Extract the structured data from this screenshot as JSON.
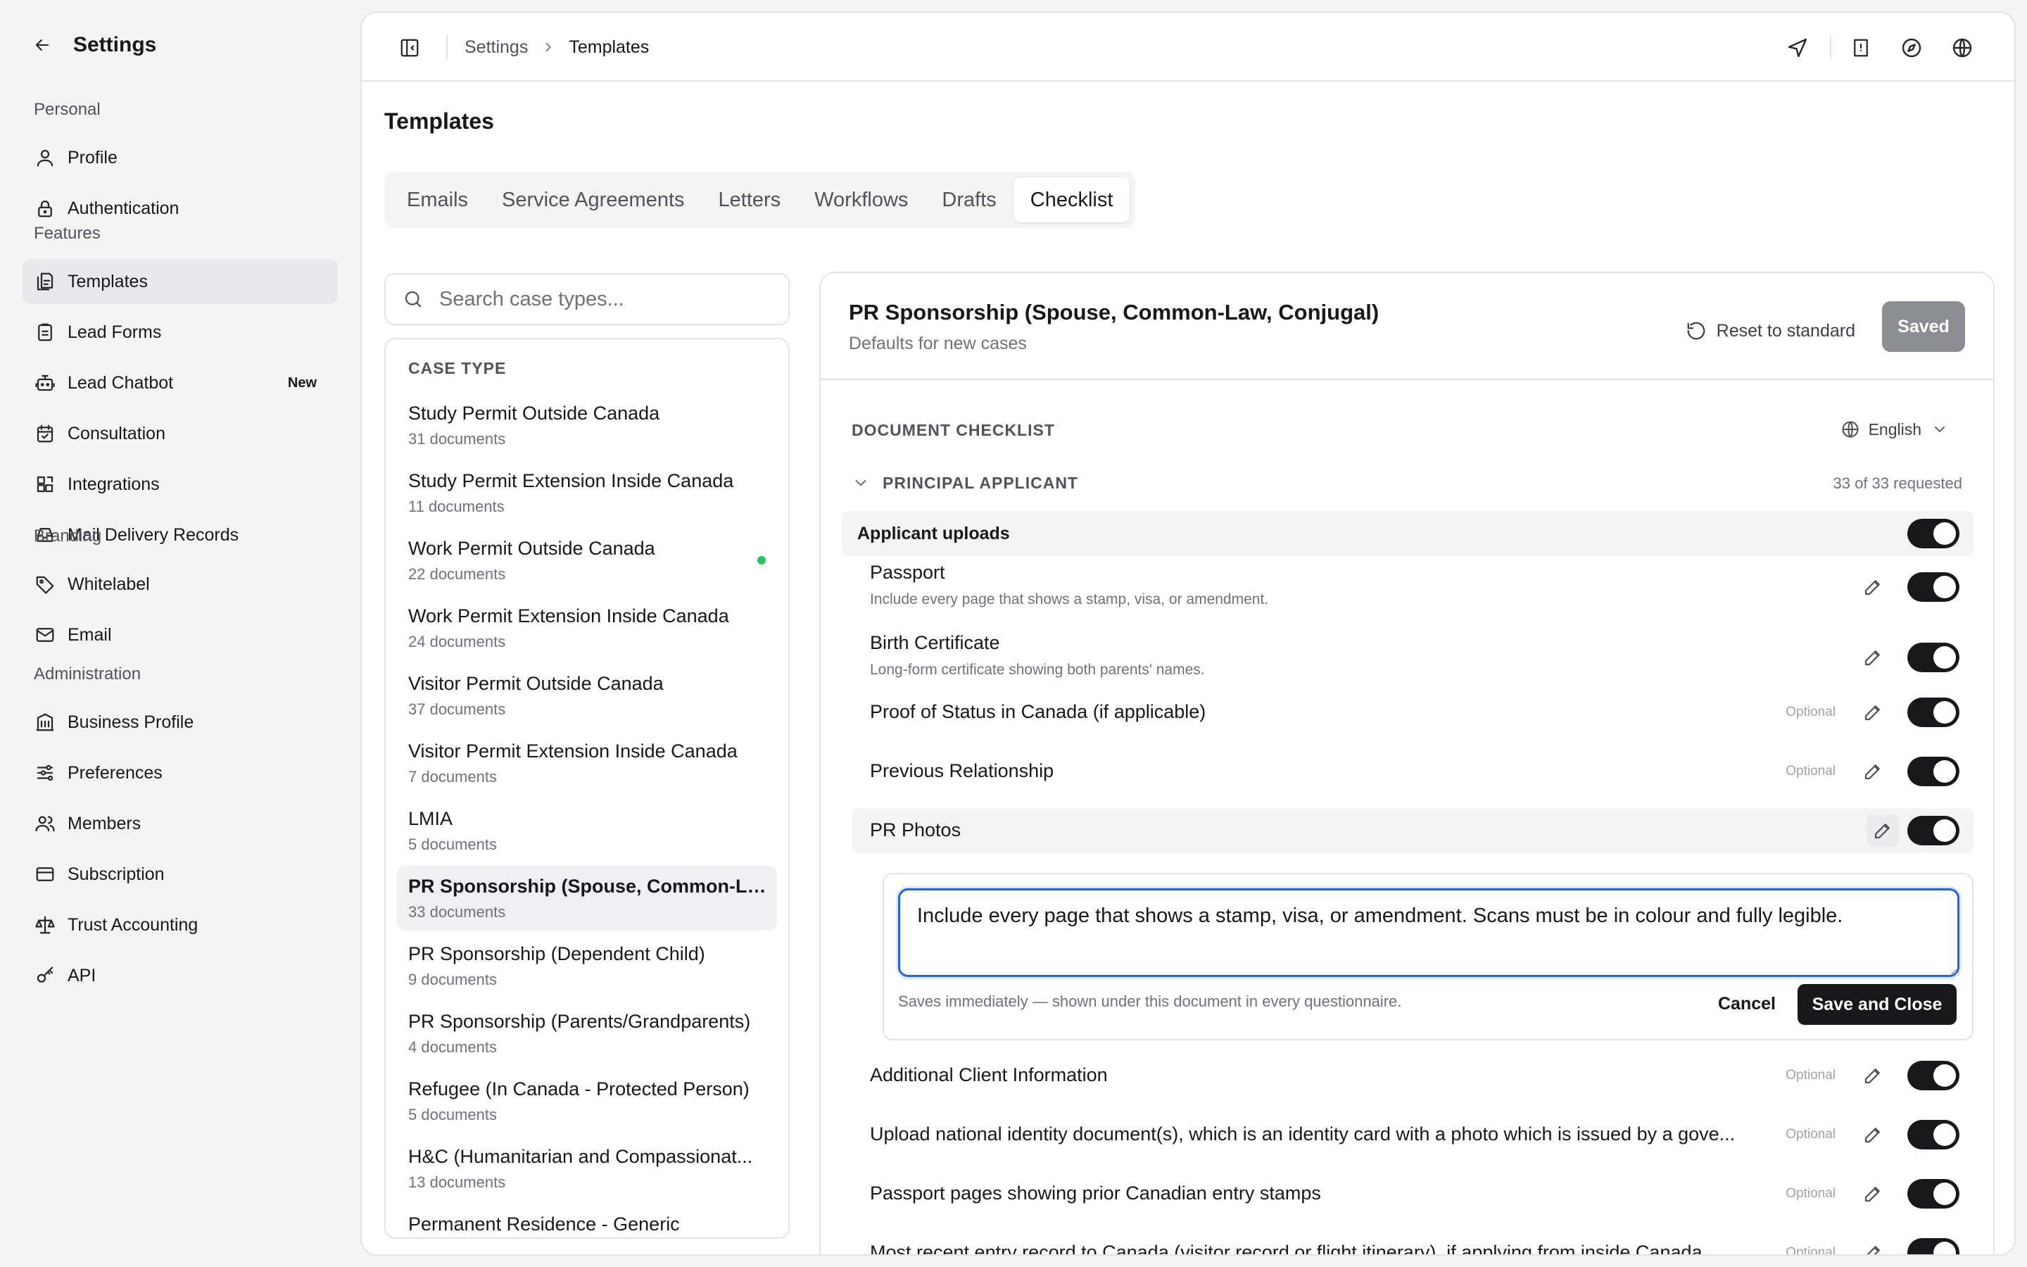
{
  "sidebar": {
    "title": "Settings",
    "groups": [
      {
        "title": "Personal",
        "items": [
          {
            "label": "Profile",
            "icon": "user-icon"
          },
          {
            "label": "Authentication",
            "icon": "lock-icon"
          }
        ]
      },
      {
        "title": "Features",
        "items": [
          {
            "label": "Templates",
            "icon": "templates-icon",
            "active": true
          },
          {
            "label": "Lead Forms",
            "icon": "clipboard-icon"
          },
          {
            "label": "Lead Chatbot",
            "icon": "bot-icon",
            "badge": "New"
          },
          {
            "label": "Consultation",
            "icon": "calendar-icon"
          },
          {
            "label": "Integrations",
            "icon": "integrations-icon"
          },
          {
            "label": "Mail Delivery Records",
            "icon": "inbox-icon"
          }
        ]
      },
      {
        "title": "Branding",
        "items": [
          {
            "label": "Whitelabel",
            "icon": "tag-icon"
          },
          {
            "label": "Email",
            "icon": "mail-icon"
          }
        ]
      },
      {
        "title": "Administration",
        "items": [
          {
            "label": "Business Profile",
            "icon": "building-icon"
          },
          {
            "label": "Preferences",
            "icon": "sliders-icon"
          },
          {
            "label": "Members",
            "icon": "users-icon"
          },
          {
            "label": "Subscription",
            "icon": "credit-card-icon"
          },
          {
            "label": "Trust Accounting",
            "icon": "scale-icon"
          },
          {
            "label": "API",
            "icon": "key-icon"
          }
        ]
      }
    ]
  },
  "breadcrumb": {
    "parent": "Settings",
    "current": "Templates"
  },
  "page": {
    "title": "Templates"
  },
  "tabs": [
    {
      "label": "Emails"
    },
    {
      "label": "Service Agreements"
    },
    {
      "label": "Letters"
    },
    {
      "label": "Workflows"
    },
    {
      "label": "Drafts"
    },
    {
      "label": "Checklist",
      "active": true
    }
  ],
  "search": {
    "placeholder": "Search case types..."
  },
  "case_list": {
    "header": "CASE TYPE",
    "items": [
      {
        "name": "Study Permit Outside Canada",
        "count": "31 documents"
      },
      {
        "name": "Study Permit Extension Inside Canada",
        "count": "11 documents"
      },
      {
        "name": "Work Permit Outside Canada",
        "count": "22 documents",
        "dot": true
      },
      {
        "name": "Work Permit Extension Inside Canada",
        "count": "24 documents"
      },
      {
        "name": "Visitor Permit Outside Canada",
        "count": "37 documents"
      },
      {
        "name": "Visitor Permit Extension Inside Canada",
        "count": "7 documents"
      },
      {
        "name": "LMIA",
        "count": "5 documents"
      },
      {
        "name": "PR Sponsorship (Spouse, Common-La...",
        "count": "33 documents",
        "active": true
      },
      {
        "name": "PR Sponsorship (Dependent Child)",
        "count": "9 documents"
      },
      {
        "name": "PR Sponsorship (Parents/Grandparents)",
        "count": "4 documents"
      },
      {
        "name": "Refugee (In Canada - Protected Person)",
        "count": "5 documents"
      },
      {
        "name": "H&C (Humanitarian and Compassionat...",
        "count": "13 documents"
      },
      {
        "name": "Permanent Residence - Generic",
        "count": ""
      }
    ]
  },
  "detail": {
    "title": "PR Sponsorship (Spouse, Common-Law, Conjugal)",
    "subtitle": "Defaults for new cases",
    "reset_label": "Reset to standard",
    "saved_label": "Saved",
    "checklist_label": "DOCUMENT CHECKLIST",
    "language": "English",
    "section_label": "PRINCIPAL APPLICANT",
    "section_count": "33 of 33 requested",
    "uploads_label": "Applicant uploads",
    "uploads_enabled": true,
    "documents": [
      {
        "name": "Passport",
        "desc": "Include every page that shows a stamp, visa, or amendment.",
        "optional": "",
        "enabled": true
      },
      {
        "name": "Birth Certificate",
        "desc": "Long-form certificate showing both parents' names.",
        "optional": "",
        "enabled": true
      },
      {
        "name": "Proof of Status in Canada (if applicable)",
        "desc": "",
        "optional": "Optional",
        "enabled": true
      },
      {
        "name": "Previous Relationship",
        "desc": "",
        "optional": "Optional",
        "enabled": true
      },
      {
        "name": "PR Photos",
        "desc": "",
        "optional": "",
        "enabled": true,
        "editing": true
      },
      {
        "name": "Additional Client Information",
        "desc": "",
        "optional": "Optional",
        "enabled": true
      },
      {
        "name": "Upload national identity document(s), which is an identity card with a photo which is issued by a gove...",
        "desc": "",
        "optional": "Optional",
        "enabled": true
      },
      {
        "name": "Passport pages showing prior Canadian entry stamps",
        "desc": "",
        "optional": "Optional",
        "enabled": true
      },
      {
        "name": "Most recent entry record to Canada (visitor record or flight itinerary), if applying from inside Canada",
        "desc": "",
        "optional": "Optional",
        "enabled": true
      }
    ],
    "editor": {
      "value": "Include every page that shows a stamp, visa, or amendment. Scans must be in colour and fully legible.",
      "hint": "Saves immediately — shown under this document in every questionnaire.",
      "cancel_label": "Cancel",
      "save_label": "Save and Close"
    }
  }
}
